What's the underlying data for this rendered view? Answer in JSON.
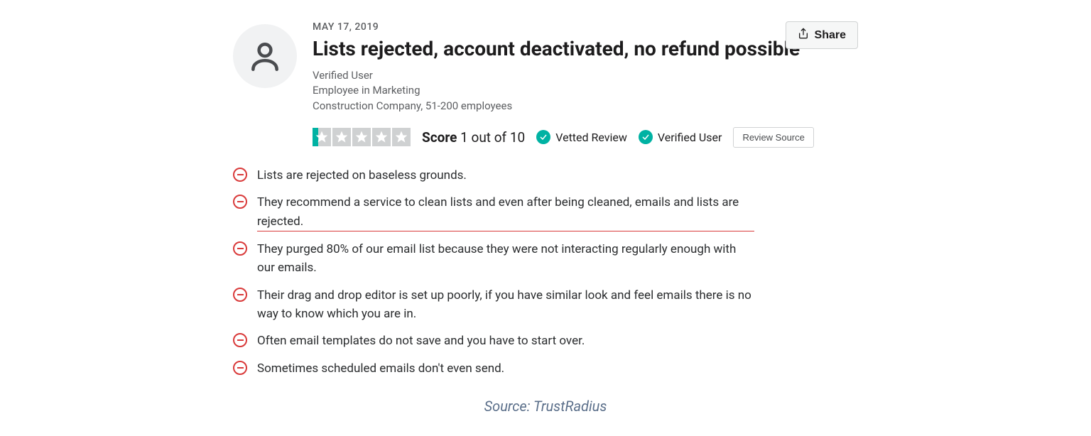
{
  "share_label": "Share",
  "date": "MAY 17, 2019",
  "title": "Lists rejected, account deactivated, no refund possible",
  "meta": {
    "line1": "Verified User",
    "line2": "Employee in Marketing",
    "line3": "Construction Company, 51-200 employees"
  },
  "score": {
    "label": "Score",
    "value": "1 out of 10"
  },
  "badges": {
    "vetted": "Vetted Review",
    "verified": "Verified User"
  },
  "review_source_label": "Review Source",
  "cons": [
    {
      "text": "Lists are rejected on baseless grounds.",
      "highlighted": false
    },
    {
      "text": "They recommend a service to clean lists and even after being cleaned, emails and lists are rejected.",
      "highlighted": true
    },
    {
      "text": "They purged 80% of our email list because they were not interacting regularly enough with our emails.",
      "highlighted": false
    },
    {
      "text": "Their drag and drop editor is set up poorly, if you have similar look and feel emails there is no way to know which you are in.",
      "highlighted": false
    },
    {
      "text": "Often email templates do not save and you have to start over.",
      "highlighted": false
    },
    {
      "text": "Sometimes scheduled emails don't even send.",
      "highlighted": false
    }
  ],
  "source_credit": "Source: TrustRadius"
}
